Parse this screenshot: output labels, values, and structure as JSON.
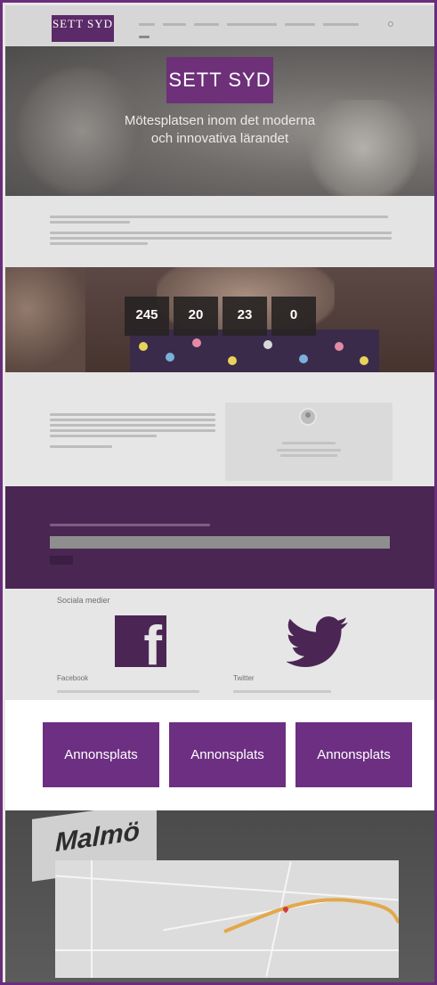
{
  "header": {
    "logo_title": "SETT SYD",
    "nav_items": [
      "",
      "",
      "",
      "",
      "",
      "",
      ""
    ]
  },
  "hero": {
    "badge": "SETT SYD",
    "tagline": "Mötesplatsen inom det moderna och innovativa lärandet"
  },
  "countdown": {
    "items": [
      {
        "value": "245",
        "label": ""
      },
      {
        "value": "20",
        "label": ""
      },
      {
        "value": "23",
        "label": ""
      },
      {
        "value": "0",
        "label": ""
      }
    ]
  },
  "social": {
    "title": "Sociala medier",
    "facebook_label": "Facebook",
    "twitter_label": "Twitter"
  },
  "ads": {
    "items": [
      "Annonsplats",
      "Annonsplats",
      "Annonsplats"
    ]
  },
  "colors": {
    "brand_purple": "#6d2f82",
    "dark_purple": "#4a2652"
  },
  "icons": [
    "facebook-icon",
    "twitter-icon",
    "search-icon"
  ]
}
